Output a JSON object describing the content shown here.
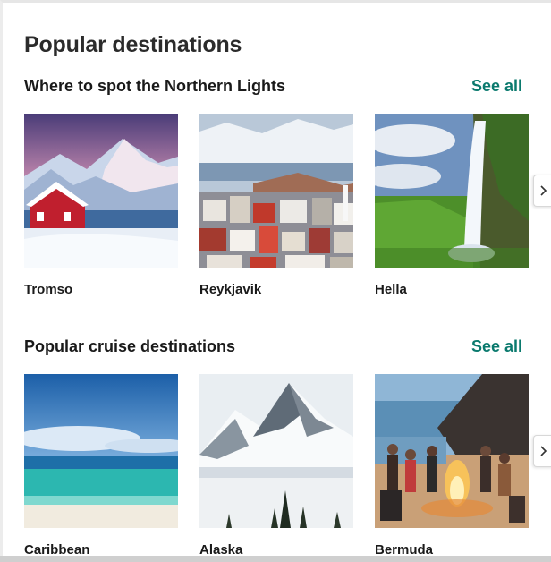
{
  "page": {
    "title": "Popular destinations"
  },
  "sections": [
    {
      "title": "Where to spot the Northern Lights",
      "see_all": "See all",
      "cards": [
        {
          "label": "Tromso",
          "image": "red-cabin-snowy-mountain-photo"
        },
        {
          "label": "Reykjavik",
          "image": "colorful-town-houses-photo"
        },
        {
          "label": "Hella",
          "image": "waterfall-green-cliff-photo"
        }
      ],
      "next_icon": "chevron-right-icon"
    },
    {
      "title": "Popular cruise destinations",
      "see_all": "See all",
      "cards": [
        {
          "label": "Caribbean",
          "image": "turquoise-sea-beach-photo"
        },
        {
          "label": "Alaska",
          "image": "snowy-peak-pine-trees-photo"
        },
        {
          "label": "Bermuda",
          "image": "beach-bonfire-people-photo"
        }
      ],
      "next_icon": "chevron-right-icon"
    }
  ],
  "colors": {
    "accent": "#0b7a6e",
    "text": "#1a1a1a"
  }
}
